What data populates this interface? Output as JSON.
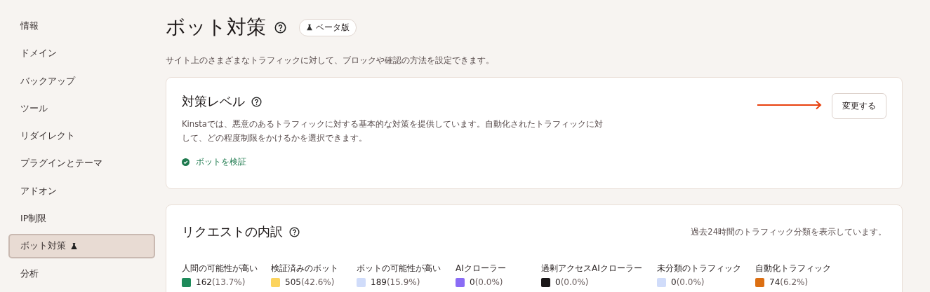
{
  "sidebar": {
    "items": [
      {
        "label": "情報",
        "selected": false,
        "beta": false
      },
      {
        "label": "ドメイン",
        "selected": false,
        "beta": false
      },
      {
        "label": "バックアップ",
        "selected": false,
        "beta": false
      },
      {
        "label": "ツール",
        "selected": false,
        "beta": false
      },
      {
        "label": "リダイレクト",
        "selected": false,
        "beta": false
      },
      {
        "label": "プラグインとテーマ",
        "selected": false,
        "beta": false
      },
      {
        "label": "アドオン",
        "selected": false,
        "beta": false
      },
      {
        "label": "IP制限",
        "selected": false,
        "beta": false
      },
      {
        "label": "ボット対策",
        "selected": true,
        "beta": true
      },
      {
        "label": "分析",
        "selected": false,
        "beta": false
      }
    ]
  },
  "page": {
    "title": "ボット対策",
    "badge": "ベータ版",
    "description": "サイト上のさまざまなトラフィックに対して、ブロックや確認の方法を設定できます。"
  },
  "protection_card": {
    "title": "対策レベル",
    "description": "Kinstaでは、悪意のあるトラフィックに対する基本的な対策を提供しています。自動化されたトラフィックに対して、どの程度制限をかけるかを選択できます。",
    "status": "ボットを検証",
    "button": "変更する"
  },
  "requests_card": {
    "title": "リクエストの内訳",
    "note": "過去24時間のトラフィック分類を表示しています。",
    "legend": [
      {
        "label": "人間の可能性が高い",
        "color": "#1e8a5a",
        "count": "162",
        "percent": "(13.7%)"
      },
      {
        "label": "検証済みのボット",
        "color": "#fcd45e",
        "count": "505",
        "percent": "(42.6%)"
      },
      {
        "label": "ボットの可能性が高い",
        "color": "#d0dcfa",
        "count": "189",
        "percent": "(15.9%)"
      },
      {
        "label": "AIクローラー",
        "color": "#8a6cf5",
        "count": "0",
        "percent": "(0.0%)"
      },
      {
        "label": "過剰アクセスAIクローラー",
        "color": "#1a1718",
        "count": "0",
        "percent": "(0.0%)"
      },
      {
        "label": "未分類のトラフィック",
        "color": "#d0dcfa",
        "count": "0",
        "percent": "(0.0%)"
      },
      {
        "label": "自動化トラフィック",
        "color": "#dc6f12",
        "count": "74",
        "percent": "(6.2%)"
      }
    ]
  }
}
